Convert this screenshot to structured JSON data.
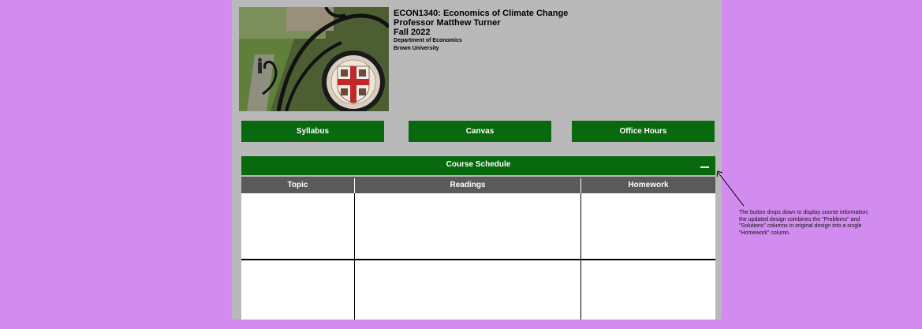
{
  "header": {
    "course_title": "ECON1340: Economics of Climate Change",
    "professor": "Professor Matthew Turner",
    "term": "Fall 2022",
    "department": "Department of Economics",
    "university": "Brown University"
  },
  "nav": {
    "syllabus": "Syllabus",
    "canvas": "Canvas",
    "office_hours": "Office Hours"
  },
  "schedule": {
    "title": "Course Schedule",
    "columns": [
      "Topic",
      "Readings",
      "Homework"
    ]
  },
  "annotation": {
    "text": "The button drops down to display course information; the updated design combines the \"Problems\" and \"Solutions\" columns in original design into a single \"Homework\" column."
  },
  "colors": {
    "page_background": "#d28cf0",
    "panel_background": "#b9b9b9",
    "button_green": "#08690e",
    "table_header": "#5a5a5a"
  }
}
